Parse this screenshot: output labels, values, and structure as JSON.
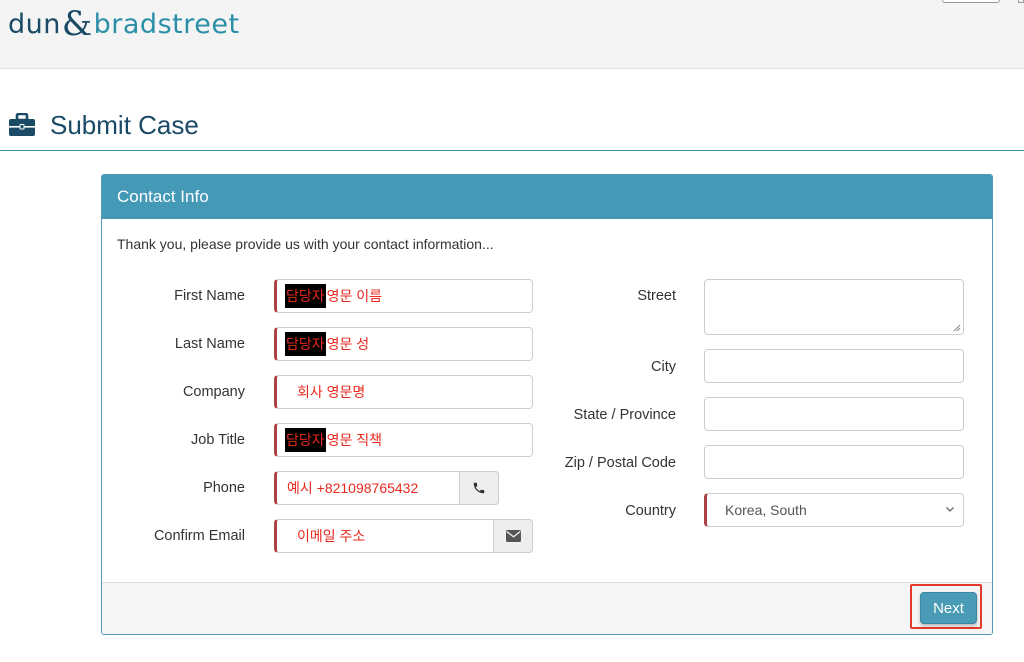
{
  "header": {
    "logo_left": "dun",
    "logo_amp": "&",
    "logo_right": "bradstreet"
  },
  "page": {
    "title": "Submit Case",
    "icon": "briefcase-icon"
  },
  "panel": {
    "heading": "Contact Info",
    "intro": "Thank you, please provide us with your contact information..."
  },
  "left_fields": {
    "first_name": {
      "label": "First Name",
      "mask": "담당자",
      "value": " 영문 이름"
    },
    "last_name": {
      "label": "Last Name",
      "mask": "담당자",
      "value": " 영문 성"
    },
    "company": {
      "label": "Company",
      "value": "회사 영문명"
    },
    "job_title": {
      "label": "Job Title",
      "mask": "담당자",
      "value": " 영문 직책"
    },
    "phone": {
      "label": "Phone",
      "value": "예시 +821098765432",
      "icon": "phone-icon"
    },
    "confirm_email": {
      "label": "Confirm Email",
      "value": "이메일 주소",
      "icon": "envelope-icon"
    }
  },
  "right_fields": {
    "street": {
      "label": "Street",
      "value": ""
    },
    "city": {
      "label": "City",
      "value": ""
    },
    "state": {
      "label": "State / Province",
      "value": ""
    },
    "zip": {
      "label": "Zip / Postal Code",
      "value": ""
    },
    "country": {
      "label": "Country",
      "value": "Korea, South",
      "icon": "chevron-down-icon"
    }
  },
  "footer": {
    "next_label": "Next"
  },
  "colors": {
    "brand_dark": "#1b4a66",
    "brand_teal": "#4499b7",
    "required_marker": "#a94442",
    "annotation_red": "#e8291f"
  }
}
